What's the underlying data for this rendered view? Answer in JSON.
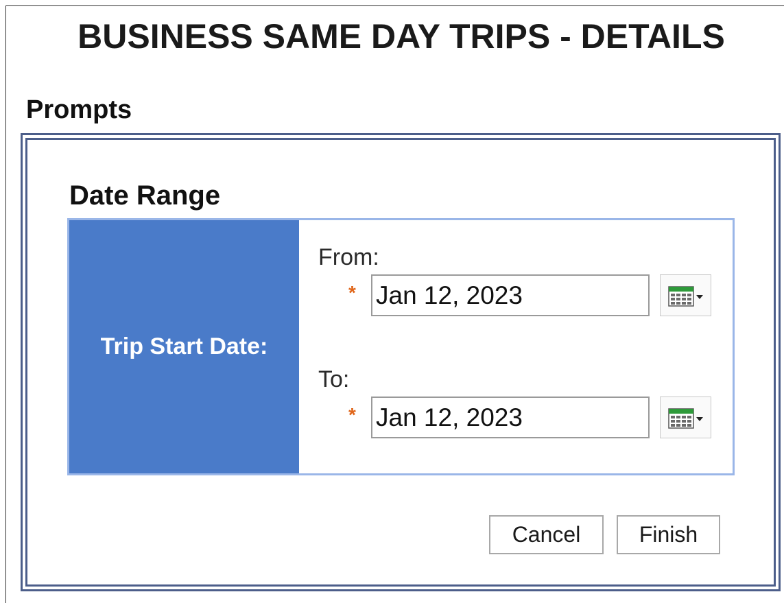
{
  "report": {
    "title": "BUSINESS SAME DAY TRIPS - DETAILS"
  },
  "prompts": {
    "heading": "Prompts",
    "date_range": {
      "heading": "Date Range",
      "label": "Trip Start Date:",
      "from": {
        "label": "From:",
        "required_mark": "*",
        "value": "Jan 12, 2023",
        "calendar_icon": "calendar-dropdown-icon"
      },
      "to": {
        "label": "To:",
        "required_mark": "*",
        "value": "Jan 12, 2023",
        "calendar_icon": "calendar-dropdown-icon"
      }
    },
    "buttons": {
      "cancel": "Cancel",
      "finish": "Finish"
    }
  },
  "colors": {
    "label_cell_bg": "#4a7bc9",
    "table_border": "#9ab6e8",
    "frame_border": "#4c5e8a",
    "required_mark": "#e0661a"
  }
}
